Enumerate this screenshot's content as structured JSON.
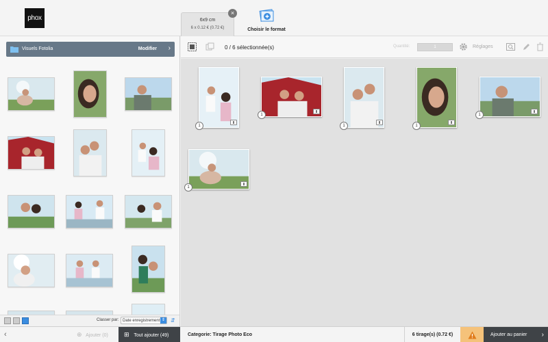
{
  "app": {
    "logo_text": "phox"
  },
  "format_tab": {
    "size": "6x9 cm",
    "price": "6 x 0.12 € (0.72 €)"
  },
  "choose_format": {
    "label": "Choisir le format"
  },
  "left_panel": {
    "header_title": "Visuels Fotolia",
    "header_action": "Modifier",
    "sort_label": "Classer par:",
    "sort_value": "Date enregistrement"
  },
  "toolbar": {
    "selection": "0 / 6 sélectionnée(s)",
    "quantity_label": "Quantité:",
    "quantity_value": "1",
    "settings_label": "Réglages"
  },
  "work_photos": [
    {
      "qty": "1"
    },
    {
      "qty": "1"
    },
    {
      "qty": "1"
    },
    {
      "qty": "1"
    },
    {
      "qty": "1"
    },
    {
      "qty": "1"
    }
  ],
  "bottom_bar": {
    "add_label": "Ajouter (0)",
    "add_all_label": "Tout ajouter (49)",
    "category": "Categorie: Tirage Photo Eco",
    "prints": "6 tirage(s) (0.72 €)",
    "cart_label": "Ajouter au panier"
  },
  "colors": {
    "accent": "#3b8de0",
    "header_bar": "#677888",
    "dark_button": "#3f4347",
    "warning": "#f5c27a"
  }
}
